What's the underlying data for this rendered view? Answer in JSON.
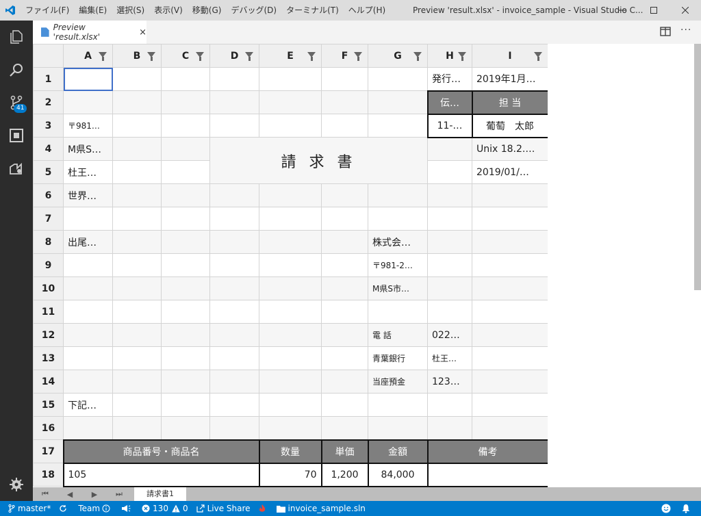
{
  "titlebar": {
    "menu": [
      "ファイル(F)",
      "編集(E)",
      "選択(S)",
      "表示(V)",
      "移動(G)",
      "デバッグ(D)",
      "ターミナル(T)",
      "ヘルプ(H)"
    ],
    "title": "Preview 'result.xlsx' - invoice_sample - Visual Studio C..."
  },
  "activity": {
    "scm_badge": "41"
  },
  "tab": {
    "label": "Preview 'result.xlsx'",
    "close": "×"
  },
  "sheet": {
    "columns": [
      "A",
      "B",
      "C",
      "D",
      "E",
      "F",
      "G",
      "H",
      "I"
    ],
    "rows": [
      "1",
      "2",
      "3",
      "4",
      "5",
      "6",
      "7",
      "8",
      "9",
      "10",
      "11",
      "12",
      "13",
      "14",
      "15",
      "16",
      "17",
      "18"
    ],
    "cells": {
      "H1": "発行…",
      "I1": "2019年1月…",
      "H2": "伝…",
      "I2": "担 当",
      "A3": "〒981…",
      "H3": "11-…",
      "I3": "葡萄　太郎",
      "A4": "M県S…",
      "D4": "請 求 書",
      "I4": "Unix 18.2.…",
      "A5": "杜王…",
      "I5": "2019/01/…",
      "A6": "世界…",
      "A8": "出尾…",
      "G8": "株式会…",
      "G9": "〒981-2…",
      "G10": "M県S市…",
      "G12": "電 話",
      "H12": "022…",
      "G13": "青葉銀行",
      "H13": "杜王…",
      "G14": "当座預金",
      "H14": "123…",
      "A15": "下記…",
      "A17": "商品番号・商品名",
      "E17": "数量",
      "F17": "単価",
      "G17": "金額",
      "H17": "備考",
      "A18": "105",
      "E18": "70",
      "F18": "1,200",
      "G18": "84,000"
    },
    "sheet_tab": "請求書1"
  },
  "statusbar": {
    "branch": "master*",
    "team": "Team",
    "errors": "130",
    "warnings": "0",
    "live_share": "Live Share",
    "solution": "invoice_sample.sln"
  },
  "colors": {
    "accent": "#007acc",
    "header_fill": "#7f7f7f"
  }
}
